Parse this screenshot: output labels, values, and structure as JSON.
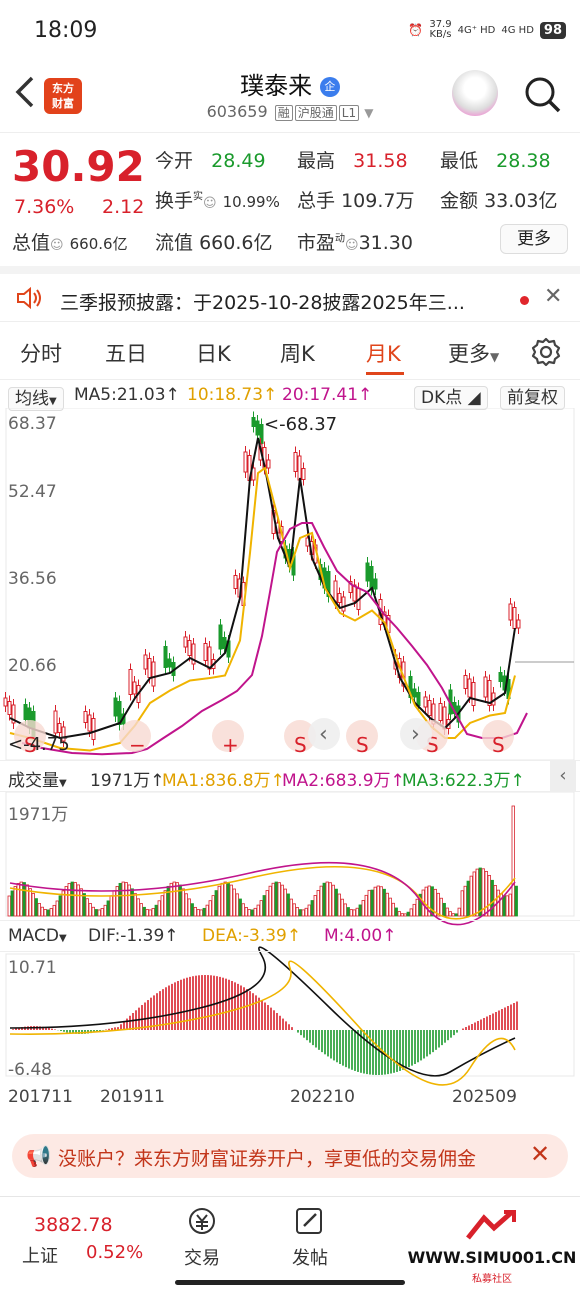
{
  "status_bar": {
    "time": "18:09",
    "speed": "37.9",
    "speed_unit": "KB/s",
    "net1": "4G⁺ HD",
    "net2": "4G HD",
    "battery": "98"
  },
  "header": {
    "logo_line1": "东方",
    "logo_line2": "财富",
    "title": "璞泰来",
    "title_badge": "企",
    "code": "603659",
    "tags": [
      "融",
      "沪股通",
      "L1"
    ]
  },
  "quote": {
    "price": "30.92",
    "change_pct": "7.36%",
    "change": "2.12",
    "open_label": "今开",
    "open": "28.49",
    "high_label": "最高",
    "high": "31.58",
    "low_label": "最低",
    "low": "28.38",
    "turnover_label": "换手",
    "turnover_sup": "实",
    "turnover": "10.99%",
    "volume_label": "总手",
    "volume": "109.7万",
    "amount_label": "金额",
    "amount": "33.03亿",
    "mcap_label": "总值",
    "mcap": "660.6亿",
    "float_label": "流值",
    "float_cap": "660.6亿",
    "pe_label": "市盈",
    "pe_sup": "动",
    "pe": "31.30",
    "more_button": "更多"
  },
  "notice": {
    "text": "三季报预披露：于2025-10-28披露2025年三..."
  },
  "tabs": [
    "分时",
    "五日",
    "日K",
    "周K",
    "月K",
    "更多"
  ],
  "active_tab": "月K",
  "kline": {
    "ma_select": "均线",
    "ma5": "MA5:21.03",
    "ma10": "10:18.73",
    "ma20": "20:17.41",
    "dk_button": "DK点",
    "fq_button": "前复权",
    "y_labels": [
      "68.37",
      "52.47",
      "36.56",
      "20.66"
    ],
    "max_note": "<-68.37",
    "min_note": "<-4.75"
  },
  "volume": {
    "select": "成交量",
    "value": "1971万",
    "ma1": "MA1:836.8万",
    "ma2": "MA2:683.9万",
    "ma3": "MA3:622.3万",
    "y_label": "1971万"
  },
  "macd": {
    "select": "MACD",
    "dif": "DIF:-1.39",
    "dea": "DEA:-3.39",
    "m": "M:4.00",
    "y_top": "10.71",
    "y_bottom": "-6.48"
  },
  "x_labels": [
    "201711",
    "201911",
    "202210",
    "202509"
  ],
  "banner": {
    "text": "没账户？来东方财富证券开户，享更低的交易佣金"
  },
  "bottom_nav": {
    "index_value": "3882.78",
    "index_name": "上证",
    "index_change": "0.52%",
    "trade": "交易",
    "post": "发帖",
    "watermark": "WWW.SIMU001.CN",
    "watermark_sub": "私募社区"
  },
  "colors": {
    "up": "#d8212b",
    "down": "#1a9a2c",
    "accent": "#e0451b",
    "ma10": "#f0b400",
    "ma20": "#c0148c"
  }
}
